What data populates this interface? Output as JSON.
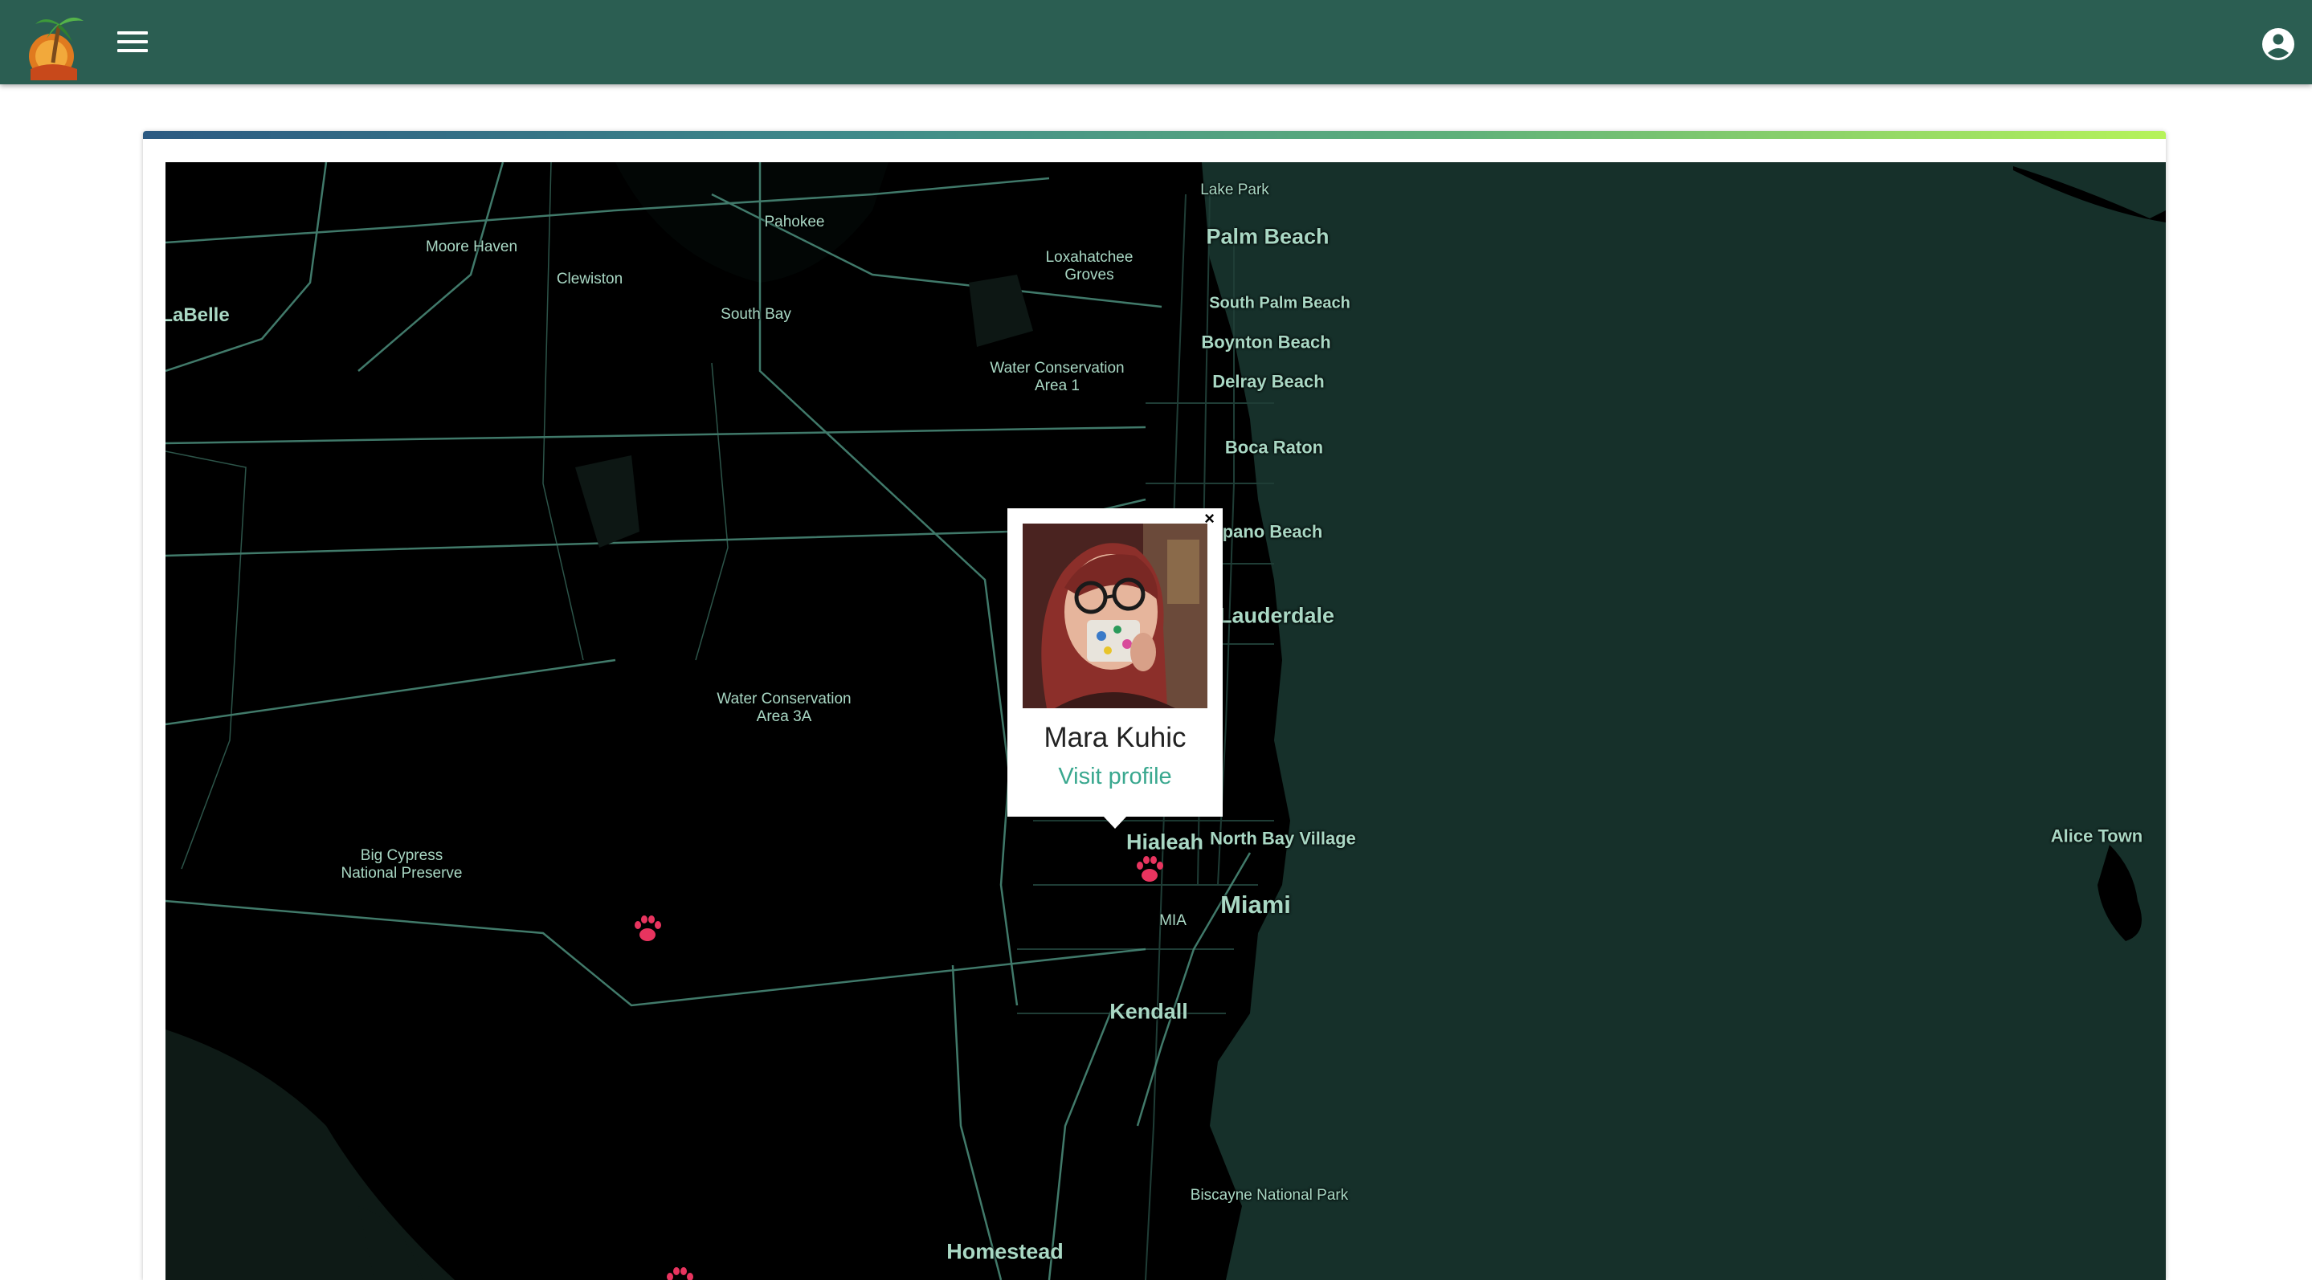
{
  "appbar": {
    "logo_icon": "palm-island-sun-logo-icon",
    "menu_icon": "hamburger-menu-icon",
    "account_icon": "account-circle-icon",
    "background": "#2b5e52"
  },
  "map": {
    "labels": [
      {
        "text": "Lake Park"
      },
      {
        "text": "Palm Beach"
      },
      {
        "text": "Pahokee"
      },
      {
        "text": "Moore Haven"
      },
      {
        "text": "Loxahatchee Groves"
      },
      {
        "text": "Clewiston"
      },
      {
        "text": "South Palm Beach"
      },
      {
        "text": "LaBelle"
      },
      {
        "text": "South Bay"
      },
      {
        "text": "Boynton Beach"
      },
      {
        "text": "Water Conservation Area 1"
      },
      {
        "text": "Delray Beach"
      },
      {
        "text": "Boca Raton"
      },
      {
        "text": "pano Beach"
      },
      {
        "text": "Lauderdale"
      },
      {
        "text": "Water Conservation Area 3A"
      },
      {
        "text": "Hialeah"
      },
      {
        "text": "North Bay Village"
      },
      {
        "text": "Big Cypress National Preserve"
      },
      {
        "text": "Miami"
      },
      {
        "text": "MIA"
      },
      {
        "text": "Kendall"
      },
      {
        "text": "Biscayne National Park"
      },
      {
        "text": "Homestead"
      },
      {
        "text": "Alice Town"
      }
    ],
    "marker_icon": "paw-print-icon",
    "marker_color": "#e8345f"
  },
  "popup": {
    "name": "Mara Kuhic",
    "link": "Visit profile",
    "close": "×",
    "link_color": "#3aa88f"
  }
}
